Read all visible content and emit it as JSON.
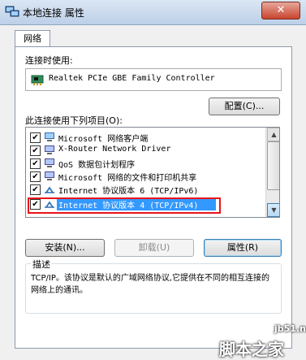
{
  "window": {
    "title": "本地连接 属性",
    "close_glyph": "✕"
  },
  "tabs": [
    {
      "label": "网络"
    }
  ],
  "connect_using": {
    "label": "连接时使用:",
    "adapter": "Realtek PCIe GBE Family Controller",
    "configure_button": "配置(C)..."
  },
  "items_section": {
    "label": "此连接使用下列项目(O):",
    "items": [
      {
        "label": "Microsoft 网络客户端",
        "checked": true,
        "icon": "network-client-icon"
      },
      {
        "label": "X-Router Network Driver",
        "checked": true,
        "icon": "network-service-icon"
      },
      {
        "label": "QoS 数据包计划程序",
        "checked": true,
        "icon": "network-service-icon"
      },
      {
        "label": "Microsoft 网络的文件和打印机共享",
        "checked": true,
        "icon": "network-service-icon"
      },
      {
        "label": "Internet 协议版本 6 (TCP/IPv6)",
        "checked": true,
        "icon": "protocol-icon"
      },
      {
        "label": "Internet 协议版本 4 (TCP/IPv4)",
        "checked": true,
        "icon": "protocol-icon",
        "selected": true
      }
    ],
    "check_glyph": "✔"
  },
  "buttons": {
    "install": "安装(N)...",
    "uninstall": "卸载(U)",
    "properties": "属性(R)"
  },
  "description": {
    "legend": "描述",
    "text": "TCP/IP。该协议是默认的广域网络协议,它提供在不同的相互连接的网络上的通讯。"
  },
  "watermark": {
    "site": "jb51.net",
    "brand": "脚本之家"
  },
  "colors": {
    "selection": "#3399ff",
    "highlight_outline": "#e8141a",
    "titlebar": "#bcd0e8"
  }
}
